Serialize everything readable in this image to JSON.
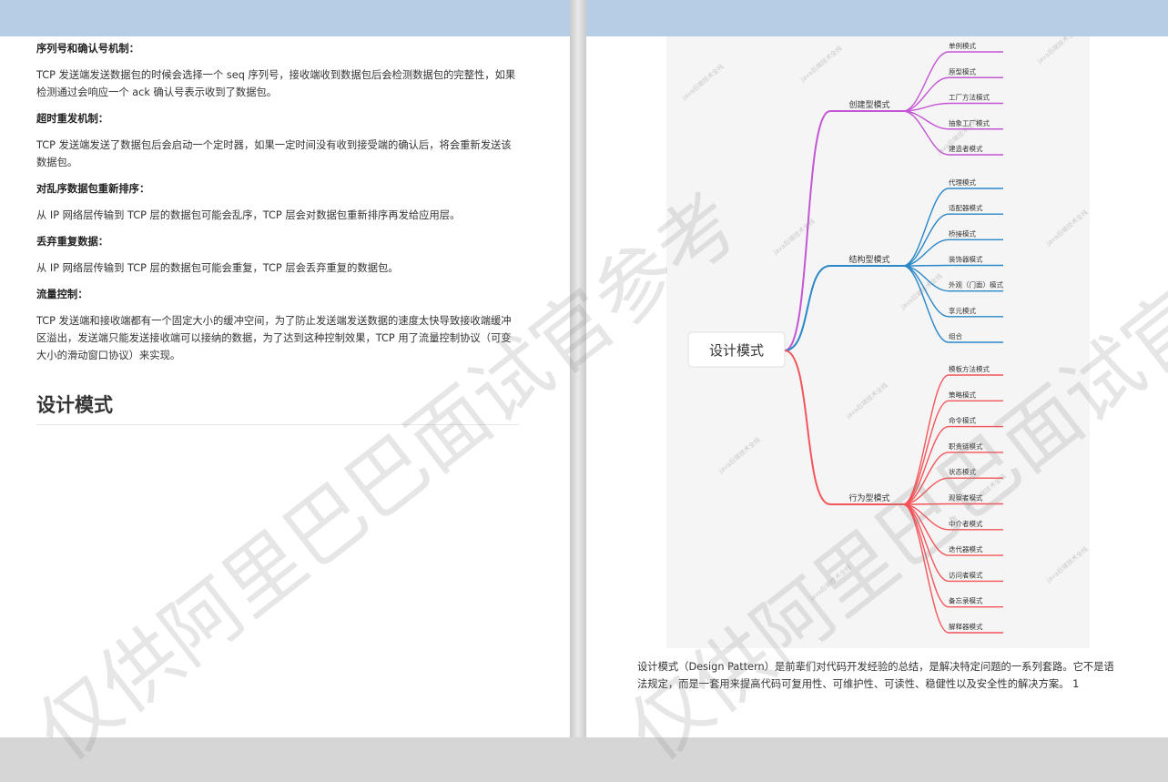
{
  "left": {
    "sections": [
      {
        "title": "序列号和确认号机制：",
        "text": "TCP 发送端发送数据包的时候会选择一个 seq 序列号，接收端收到数据包后会检测数据包的完整性，如果检测通过会响应一个 ack 确认号表示收到了数据包。"
      },
      {
        "title": "超时重发机制：",
        "text": "TCP 发送端发送了数据包后会启动一个定时器，如果一定时间没有收到接受端的确认后，将会重新发送该数据包。"
      },
      {
        "title": "对乱序数据包重新排序：",
        "text": "从 IP 网络层传输到 TCP 层的数据包可能会乱序，TCP 层会对数据包重新排序再发给应用层。"
      },
      {
        "title": "丢弃重复数据：",
        "text": "从 IP 网络层传输到 TCP 层的数据包可能会重复，TCP 层会丢弃重复的数据包。"
      },
      {
        "title": "流量控制：",
        "text": "TCP 发送端和接收端都有一个固定大小的缓冲空间，为了防止发送端发送数据的速度太快导致接收端缓冲区溢出，发送端只能发送接收端可以接纳的数据，为了达到这种控制效果，TCP 用了流量控制协议（可变大小的滑动窗口协议）来实现。"
      }
    ],
    "heading": "设计模式"
  },
  "mindmap": {
    "root": "设计模式",
    "branches": [
      {
        "name": "创建型模式",
        "color": "#c455d4",
        "items": [
          "单例模式",
          "原型模式",
          "工厂方法模式",
          "抽象工厂模式",
          "建造者模式"
        ]
      },
      {
        "name": "结构型模式",
        "color": "#2a87c8",
        "items": [
          "代理模式",
          "适配器模式",
          "桥接模式",
          "装饰器模式",
          "外观（门面）模式",
          "享元模式",
          "组合"
        ]
      },
      {
        "name": "行为型模式",
        "color": "#f4555a",
        "items": [
          "模板方法模式",
          "策略模式",
          "命令模式",
          "职责链模式",
          "状态模式",
          "观察者模式",
          "中介者模式",
          "迭代器模式",
          "访问者模式",
          "备忘录模式",
          "解释器模式"
        ]
      }
    ],
    "small_watermark": "java后端技术全栈"
  },
  "right": {
    "paragraph": "设计模式（Design Pattern）是前辈们对代码开发经验的总结，是解决特定问题的一系列套路。它不是语法规定，而是一套用来提高代码可复用性、可维护性、可读性、稳健性以及安全性的解决方案。 1"
  },
  "watermark": {
    "text": "仅供阿里巴巴面试官参考"
  }
}
